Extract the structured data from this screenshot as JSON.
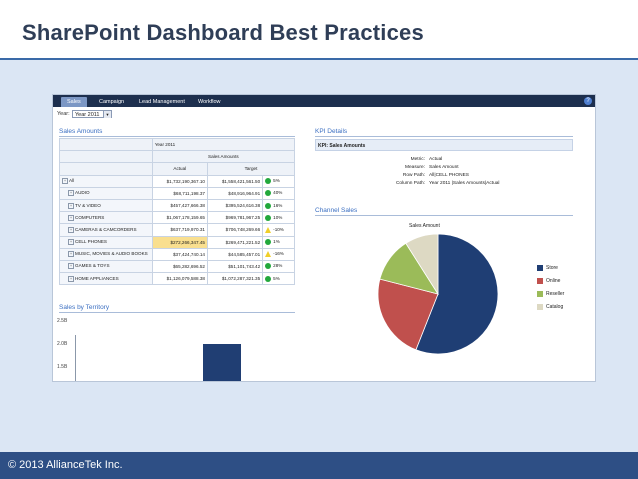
{
  "slide": {
    "title": "SharePoint Dashboard Best Practices",
    "footer": "© 2013  AllianceTek Inc."
  },
  "tabs": [
    {
      "label": "Sales",
      "active": true
    },
    {
      "label": "Campaign"
    },
    {
      "label": "Lead Management"
    },
    {
      "label": "Workflow"
    }
  ],
  "filter": {
    "year_label": "Year:",
    "year_value": "Year 2011"
  },
  "sales_amounts": {
    "title": "Sales Amounts",
    "year_header": "Year 2011",
    "measure_header": "Sales Amounts",
    "col_actual": "Actual",
    "col_target": "Target",
    "rows": [
      {
        "label": "All",
        "actual": "$1,732,190,367.10",
        "target": "$1,558,421,561.50",
        "pct": "5%",
        "status": "good"
      },
      {
        "label": "AUDIO",
        "actual": "$68,711,198.37",
        "target": "$48,916,964.91",
        "pct": "40%",
        "status": "good"
      },
      {
        "label": "TV & VIDEO",
        "actual": "$457,427,666.38",
        "target": "$395,524,616.38",
        "pct": "16%",
        "status": "good"
      },
      {
        "label": "COMPUTERS",
        "actual": "$1,067,178,159.65",
        "target": "$969,781,967.25",
        "pct": "10%",
        "status": "good"
      },
      {
        "label": "CAMERAS & CAMCORDERS",
        "actual": "$637,719,970.31",
        "target": "$706,748,269.66",
        "pct": "-10%",
        "status": "warn"
      },
      {
        "label": "CELL PHONES",
        "actual": "$272,266,347.45",
        "target": "$269,471,221.52",
        "pct": "1%",
        "status": "good",
        "highlight": true
      },
      {
        "label": "MUSIC, MOVIES & AUDIO BOOKS",
        "actual": "$37,424,740.14",
        "target": "$44,585,457.01",
        "pct": "-16%",
        "status": "warn"
      },
      {
        "label": "GAMES & TOYS",
        "actual": "$65,282,696.52",
        "target": "$51,101,743.42",
        "pct": "28%",
        "status": "good"
      },
      {
        "label": "HOME APPLIANCES",
        "actual": "$1,126,079,588.38",
        "target": "$1,072,287,321.35",
        "pct": "5%",
        "status": "good"
      }
    ]
  },
  "kpi": {
    "title": "KPI Details",
    "header": "KPI: Sales Amounts",
    "details": [
      {
        "key": "Metric:",
        "value": "Actual"
      },
      {
        "key": "Measure:",
        "value": "Sales Amount"
      },
      {
        "key": "Row Path:",
        "value": "All|CELL PHONES"
      },
      {
        "key": "Column Path:",
        "value": "Year 2011 |Sales Amounts|Actual"
      }
    ]
  },
  "channel_sales": {
    "title": "Channel Sales",
    "chart_title": "Sales Amount",
    "slices": [
      {
        "name": "Store",
        "value": 56,
        "color": "#1f3e74"
      },
      {
        "name": "Online",
        "value": 23,
        "color": "#c0504d"
      },
      {
        "name": "Reseller",
        "value": 12,
        "color": "#9bbb59"
      },
      {
        "name": "Catalog",
        "value": 9,
        "color": "#ddd9c3"
      }
    ]
  },
  "territory": {
    "title": "Sales by Territory",
    "yticks": [
      "2.5B",
      "2.0B",
      "1.5B"
    ],
    "bars": [
      {
        "value": 2.0,
        "color": "#203e73"
      }
    ]
  }
}
